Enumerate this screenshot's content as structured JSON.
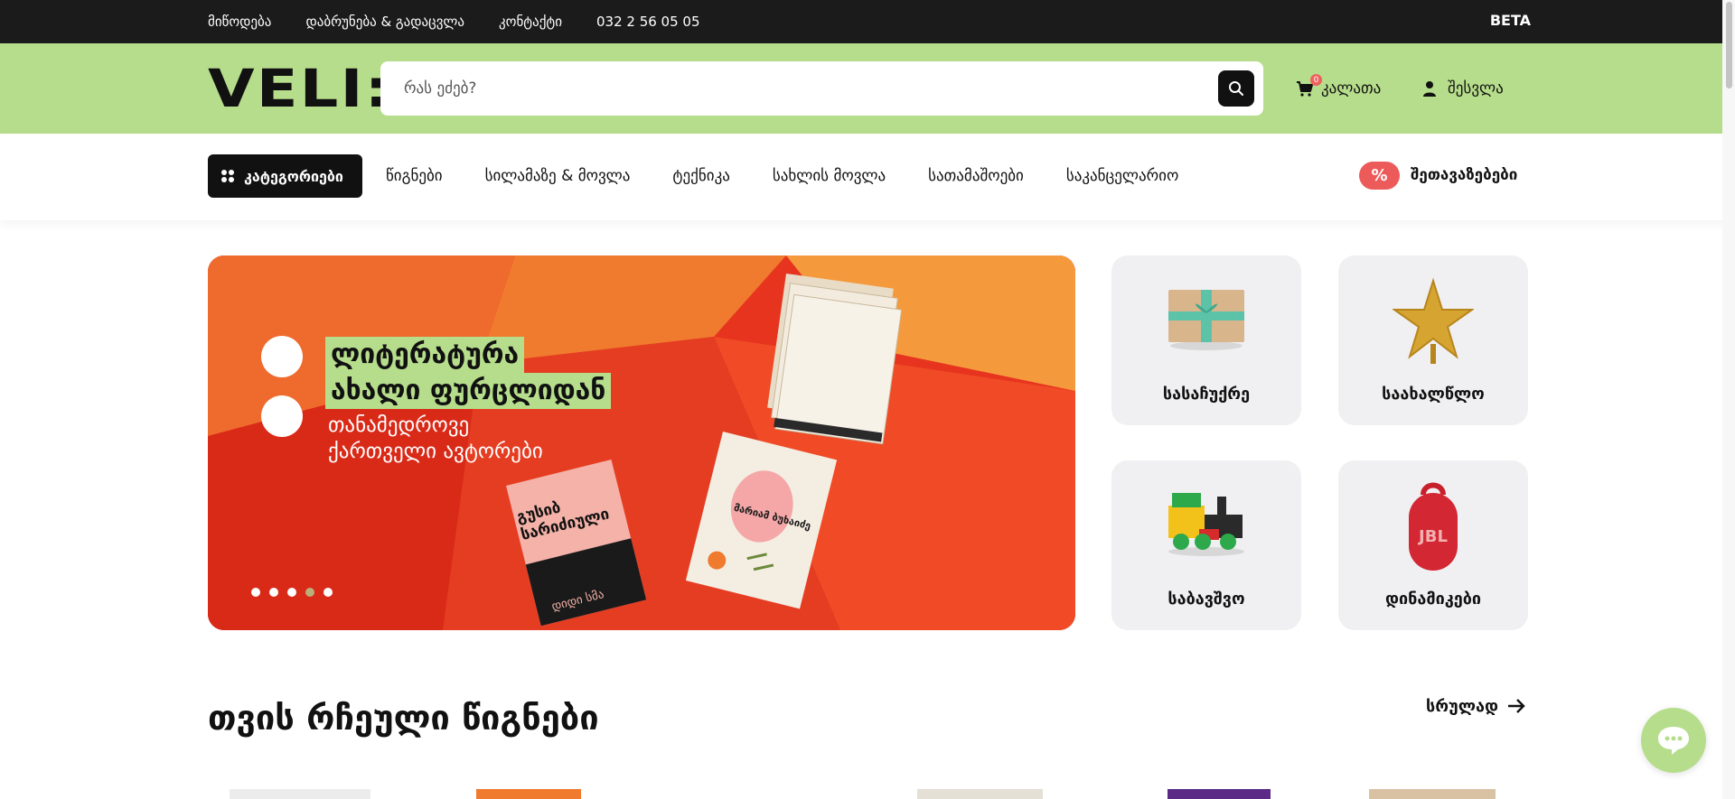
{
  "topbar": {
    "links": [
      "მიწოდება",
      "დაბრუნება & გადაცვლა",
      "კონტაქტი",
      "032 2 56 05 05"
    ],
    "beta": "BETA"
  },
  "header": {
    "logo": "VELI:",
    "search_placeholder": "რას ეძებ?",
    "cart_label": "კალათა",
    "cart_count": "0",
    "login_label": "შესვლა"
  },
  "nav": {
    "categories_label": "კატეგორიები",
    "items": [
      "წიგნები",
      "სილამაზე & მოვლა",
      "ტექნიკა",
      "სახლის მოვლა",
      "სათამაშოები",
      "საკანცელარიო"
    ],
    "offers_badge": "%",
    "offers_label": "შეთავაზებები"
  },
  "banner": {
    "headline_1": "ლიტერატურა",
    "headline_2": "ახალი ფურცლიდან",
    "sub_1": "თანამედროვე",
    "sub_2": "ქართველი ავტორები",
    "book_1_title": "გუსიბ სარიძიული",
    "book_1_author": "დიდი სმა",
    "book_2_title": "მარიამ ბუხაიძე",
    "slides_count": 5,
    "active_slide": 4
  },
  "tiles": [
    {
      "label": "სასაჩუქრე",
      "icon": "gift-box-icon"
    },
    {
      "label": "საახალწლო",
      "icon": "star-icon"
    },
    {
      "label": "საბავშვო",
      "icon": "toy-train-icon"
    },
    {
      "label": "დინამიკები",
      "icon": "speaker-icon"
    }
  ],
  "section": {
    "title": "თვის რჩეული წიგნები",
    "see_all": "სრულად"
  },
  "colors": {
    "accent_green": "#b6dd8b",
    "dark": "#1b1b1b",
    "sale_red": "#ec5a5a",
    "banner_red": "#e8321f"
  }
}
